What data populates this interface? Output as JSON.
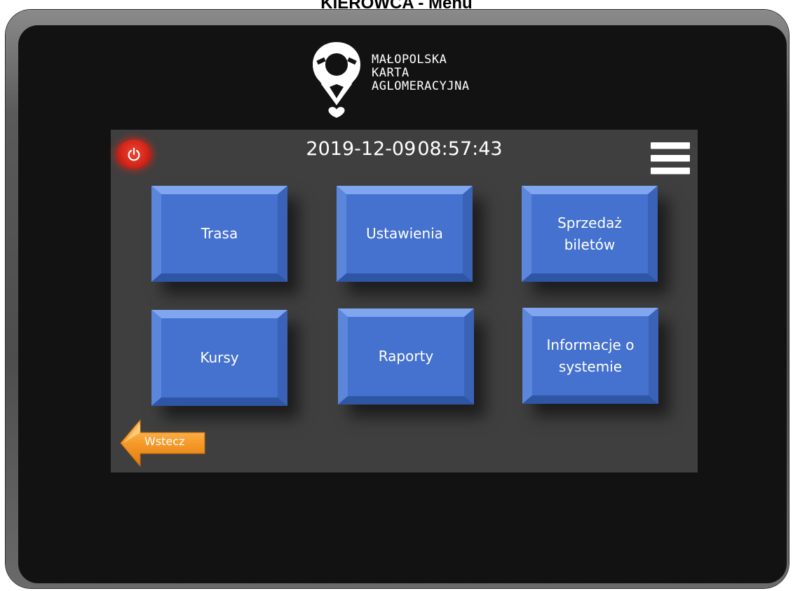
{
  "header": {
    "title": "KIEROWCA - Menu"
  },
  "logo": {
    "line1": "MAŁOPOLSKA",
    "line2": "KARTA",
    "line3": "AGLOMERACYJNA"
  },
  "status": {
    "date": "2019-12-09",
    "time": "08:57:43"
  },
  "menu": {
    "tiles": [
      {
        "label": "Trasa"
      },
      {
        "label": "Ustawienia"
      },
      {
        "label": "Sprzedaż\nbiletów"
      },
      {
        "label": "Kursy"
      },
      {
        "label": "Raporty"
      },
      {
        "label": "Informacje o\nsystemie"
      }
    ]
  },
  "navigation": {
    "back_label": "Wstecz"
  },
  "icons": {
    "power": "power-icon",
    "menu": "hamburger-menu-icon",
    "back": "arrow-left-icon",
    "logo": "location-pin-logo"
  },
  "colors": {
    "tile_blue": "#4572cf",
    "power_red": "#d2261b",
    "back_orange": "#f59b2a",
    "screen_bg": "#3f3f3f",
    "bezel": "#121212"
  }
}
